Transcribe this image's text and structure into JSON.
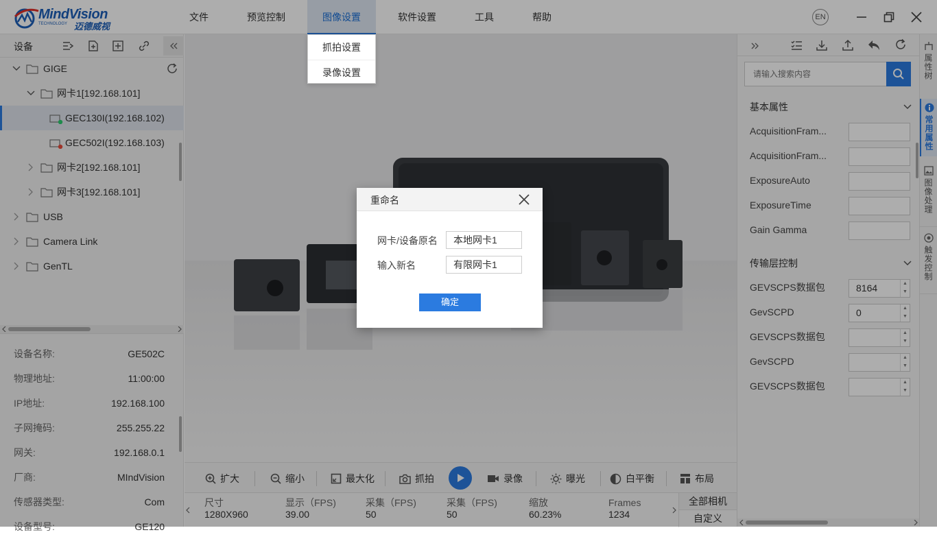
{
  "app": {
    "brand": "MindVision",
    "brand_sub": "迈德威视",
    "brand_tag": "TECHNOLOGY",
    "lang_button": "EN"
  },
  "menu": {
    "items": [
      {
        "label": "文件"
      },
      {
        "label": "预览控制"
      },
      {
        "label": "图像设置"
      },
      {
        "label": "软件设置"
      },
      {
        "label": "工具"
      },
      {
        "label": "帮助"
      }
    ],
    "active_index": 2
  },
  "dropdown": {
    "items": [
      {
        "label": "抓拍设置"
      },
      {
        "label": "录像设置"
      }
    ]
  },
  "devices": {
    "header": "设备",
    "tree": [
      {
        "label": "GIGE"
      },
      {
        "label": "网卡1[192.168.101]"
      },
      {
        "label": "GEC130I(192.168.102)",
        "status": "online"
      },
      {
        "label": "GEC502I(192.168.103)",
        "status": "offline"
      },
      {
        "label": "网卡2[192.168.101]"
      },
      {
        "label": "网卡3[192.168.101]"
      },
      {
        "label": "USB"
      },
      {
        "label": "Camera Link"
      },
      {
        "label": "GenTL"
      }
    ]
  },
  "device_info": {
    "rows": [
      {
        "label": "设备名称:",
        "value": "GE502C"
      },
      {
        "label": "物理地址:",
        "value": "11:00:00"
      },
      {
        "label": "IP地址:",
        "value": "192.168.100"
      },
      {
        "label": "子网掩码:",
        "value": "255.255.22"
      },
      {
        "label": "网关:",
        "value": "192.168.0.1"
      },
      {
        "label": "厂商:",
        "value": "MIndVision"
      },
      {
        "label": "传感器类型:",
        "value": "Com"
      },
      {
        "label": "设备型号:",
        "value": "GE120"
      }
    ]
  },
  "toolbar": {
    "zoom_in": "扩大",
    "zoom_out": "缩小",
    "maximize": "最大化",
    "snapshot": "抓拍",
    "record": "录像",
    "exposure": "曝光",
    "white_balance": "白平衡",
    "layout": "布局"
  },
  "status": {
    "cols": [
      {
        "label": "尺寸",
        "value": "1280X960"
      },
      {
        "label": "显示（FPS)",
        "value": "39.00"
      },
      {
        "label": "采集（FPS)",
        "value": "50"
      },
      {
        "label": "采集（FPS)",
        "value": "50"
      },
      {
        "label": "缩放",
        "value": "60.23%"
      },
      {
        "label": "Frames",
        "value": "1234"
      }
    ],
    "all_cameras": "全部相机",
    "custom": "自定义"
  },
  "properties": {
    "search_placeholder": "请输入搜索内容",
    "sections": [
      {
        "title": "基本属性",
        "rows": [
          {
            "label": "AcquisitionFram...",
            "value": ""
          },
          {
            "label": "AcquisitionFram...",
            "value": ""
          },
          {
            "label": "ExposureAuto",
            "value": ""
          },
          {
            "label": "ExposureTime",
            "value": ""
          },
          {
            "label": "Gain Gamma",
            "value": ""
          }
        ]
      },
      {
        "title": "传输层控制",
        "rows": [
          {
            "label": "GEVSCPS数据包",
            "value": "8164"
          },
          {
            "label": "GevSCPD",
            "value": "0"
          },
          {
            "label": "GEVSCPS数据包",
            "value": ""
          },
          {
            "label": "GevSCPD",
            "value": ""
          },
          {
            "label": "GEVSCPS数据包",
            "value": ""
          }
        ]
      }
    ]
  },
  "side_tabs": [
    {
      "label": "属性树"
    },
    {
      "label": "常用属性"
    },
    {
      "label": "图像处理"
    },
    {
      "label": "触发控制"
    }
  ],
  "dialog": {
    "title": "重命名",
    "original_label": "网卡/设备原名",
    "original_value": "本地网卡1",
    "new_label": "输入新名",
    "new_value": "有限网卡1",
    "confirm": "确定"
  },
  "colors": {
    "accent": "#2b7be0",
    "online": "#2ecc71",
    "offline": "#e74c3c"
  }
}
